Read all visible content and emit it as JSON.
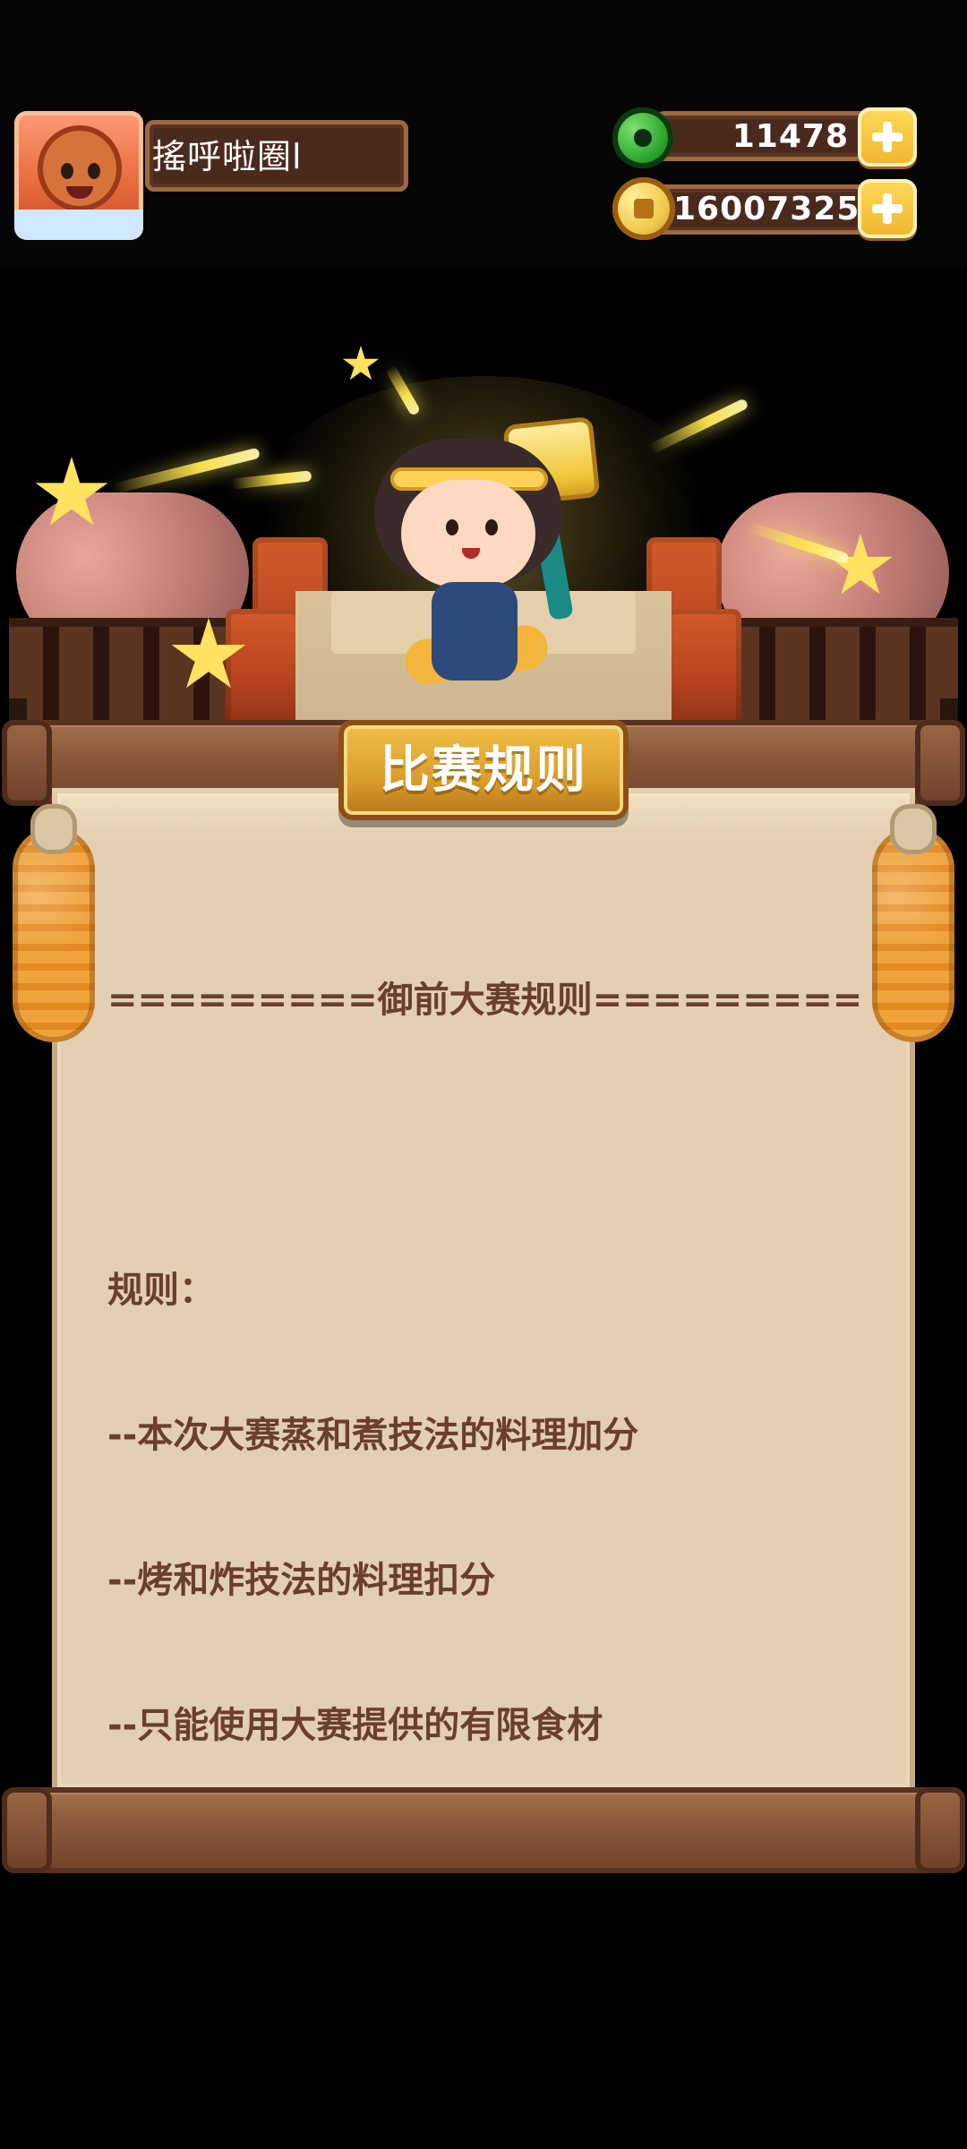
{
  "player": {
    "name": "搖呼啦圈l"
  },
  "currencies": {
    "gems": "11478",
    "coins": "16007325"
  },
  "panel": {
    "title": "比赛规则",
    "rules": {
      "header": "=========御前大赛规则=========",
      "label": "规则：",
      "lines": [
        "--本次大赛蒸和煮技法的料理加分",
        "--烤和炸技法的料理扣分",
        "--只能使用大赛提供的有限食材"
      ]
    }
  },
  "icons": {
    "gem": "green-gem-icon",
    "coin": "gold-coin-icon",
    "add": "plus-icon"
  },
  "colors": {
    "background": "#000000",
    "wood": "#8b5a3a",
    "paper": "#e3cfb1",
    "accent_gold": "#f3c24c",
    "text_brown": "#6a3f2c"
  }
}
